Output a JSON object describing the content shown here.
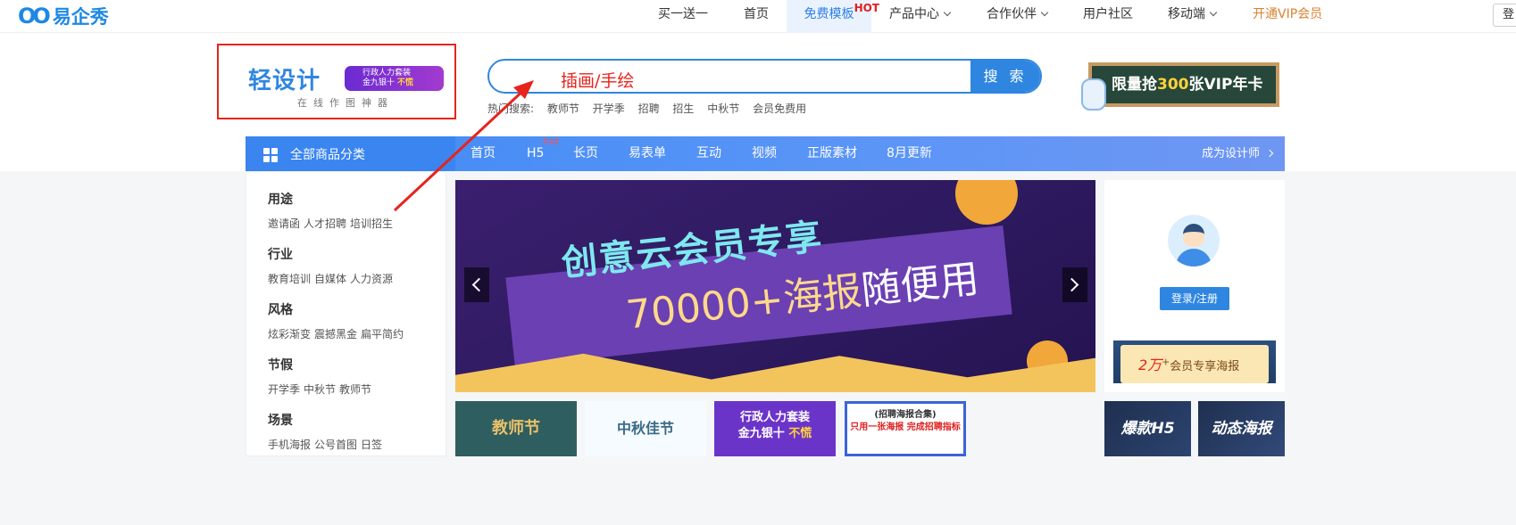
{
  "brand": {
    "logo_mark": "OO",
    "logo_name": "易企秀"
  },
  "topnav": {
    "items": [
      "买一送一",
      "首页",
      "免费模板",
      "产品中心",
      "合作伙伴",
      "用户社区",
      "移动端",
      "开通VIP会员"
    ],
    "hot_badge": "HOT",
    "right_button": "登"
  },
  "designer_logo": {
    "title": "轻设计",
    "subtitle": "在线作图神器",
    "badge_line1": "行政人力套装",
    "badge_line2": "金九银十",
    "badge_line2_highlight": "不慌"
  },
  "search": {
    "value": "",
    "button": "搜 索",
    "annotation": "插画/手绘",
    "hot_label": "热门搜索:",
    "hot_terms": [
      "教师节",
      "开学季",
      "招聘",
      "招生",
      "中秋节",
      "会员免费用"
    ]
  },
  "vip_card": {
    "prefix": "限量抢",
    "number": "300",
    "suffix": "张VIP年卡"
  },
  "category_bar": {
    "all_label": "全部商品分类",
    "nav": [
      "首页",
      "H5",
      "长页",
      "易表单",
      "互动",
      "视频",
      "正版素材",
      "8月更新"
    ],
    "hot_tag": "hot",
    "designer": "成为设计师"
  },
  "side_groups": [
    {
      "title": "用途",
      "links": [
        "邀请函",
        "人才招聘",
        "培训招生"
      ]
    },
    {
      "title": "行业",
      "links": [
        "教育培训",
        "自媒体",
        "人力资源"
      ]
    },
    {
      "title": "风格",
      "links": [
        "炫彩渐变",
        "震撼黑金",
        "扁平简约"
      ]
    },
    {
      "title": "节假",
      "links": [
        "开学季",
        "中秋节",
        "教师节"
      ]
    },
    {
      "title": "场景",
      "links": [
        "手机海报",
        "公号首图",
        "日签"
      ]
    }
  ],
  "banner": {
    "line1": "创意云会员专享",
    "line2_prefix": "70000+海报",
    "line2_suffix": "随便用"
  },
  "thumbnails": {
    "t1": "教师节",
    "t2": "中秋佳节",
    "t3_line1": "行政人力套装",
    "t3_line2": "金九银十",
    "t3_hl": "不慌",
    "t4_line1": "(招聘海报合集)",
    "t4_line2": "只用一张海报 完成招聘指标"
  },
  "user_panel": {
    "login": "登录/注册",
    "member_number": "2万",
    "member_plus": "+",
    "member_text": "会员专享海报"
  },
  "tiles": [
    "爆款H5",
    "动态海报"
  ],
  "colors": {
    "primary": "#2f86e0",
    "annotation": "#e8231b",
    "vip": "#d8822e"
  }
}
